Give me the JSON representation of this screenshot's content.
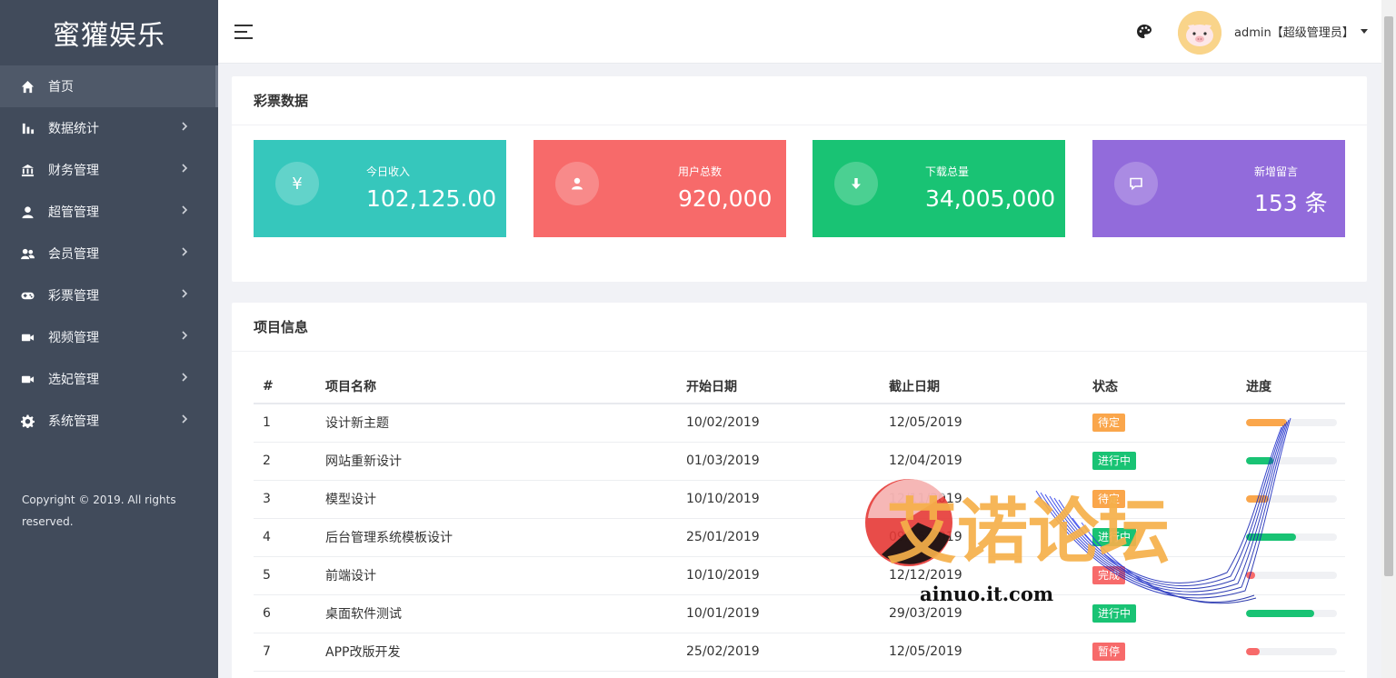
{
  "brand": "蜜獾娱乐",
  "sidebar": {
    "items": [
      {
        "label": "首页",
        "icon": "home-icon",
        "active": true
      },
      {
        "label": "数据统计",
        "icon": "bar-chart-icon"
      },
      {
        "label": "财务管理",
        "icon": "bank-icon"
      },
      {
        "label": "超管管理",
        "icon": "user-icon"
      },
      {
        "label": "会员管理",
        "icon": "users-icon"
      },
      {
        "label": "彩票管理",
        "icon": "gamepad-icon"
      },
      {
        "label": "视频管理",
        "icon": "video-icon"
      },
      {
        "label": "选妃管理",
        "icon": "video-icon"
      },
      {
        "label": "系统管理",
        "icon": "gear-icon"
      }
    ],
    "copyright": "Copyright © 2019. All rights reserved."
  },
  "topbar": {
    "user": "admin【超级管理员】"
  },
  "stats_card": {
    "title": "彩票数据",
    "items": [
      {
        "label": "今日收入",
        "value": "102,125.00",
        "icon": "yen-icon",
        "color": "#36c7bc"
      },
      {
        "label": "用户总数",
        "value": "920,000",
        "icon": "user-icon",
        "color": "#f76a6a"
      },
      {
        "label": "下载总量",
        "value": "34,005,000",
        "icon": "download-icon",
        "color": "#19c374"
      },
      {
        "label": "新增留言",
        "value": "153 条",
        "icon": "message-icon",
        "color": "#926bdb"
      }
    ]
  },
  "table_card": {
    "title": "项目信息",
    "headers": [
      "#",
      "项目名称",
      "开始日期",
      "截止日期",
      "状态",
      "进度"
    ],
    "rows": [
      {
        "id": "1",
        "name": "设计新主题",
        "start": "10/02/2019",
        "end": "12/05/2019",
        "status": "待定",
        "status_color": "#faa64b",
        "progress": 45,
        "progress_color": "#faa64b"
      },
      {
        "id": "2",
        "name": "网站重新设计",
        "start": "01/03/2019",
        "end": "12/04/2019",
        "status": "进行中",
        "status_color": "#19c374",
        "progress": 30,
        "progress_color": "#19c374"
      },
      {
        "id": "3",
        "name": "模型设计",
        "start": "10/10/2019",
        "end": "12/11/2019",
        "status": "待定",
        "status_color": "#faa64b",
        "progress": 25,
        "progress_color": "#faa64b"
      },
      {
        "id": "4",
        "name": "后台管理系统模板设计",
        "start": "25/01/2019",
        "end": "09/05/2019",
        "status": "进行中",
        "status_color": "#19c374",
        "progress": 55,
        "progress_color": "#19c374"
      },
      {
        "id": "5",
        "name": "前端设计",
        "start": "10/10/2019",
        "end": "12/12/2019",
        "status": "完成",
        "status_color": "#f76a6a",
        "progress": 10,
        "progress_color": "#f76a6a"
      },
      {
        "id": "6",
        "name": "桌面软件测试",
        "start": "10/01/2019",
        "end": "29/03/2019",
        "status": "进行中",
        "status_color": "#19c374",
        "progress": 75,
        "progress_color": "#19c374"
      },
      {
        "id": "7",
        "name": "APP改版开发",
        "start": "25/02/2019",
        "end": "12/05/2019",
        "status": "暂停",
        "status_color": "#f76a6a",
        "progress": 15,
        "progress_color": "#f76a6a"
      }
    ]
  },
  "watermark": {
    "text": "艾诺论坛",
    "url": "ainuo.it.com"
  }
}
